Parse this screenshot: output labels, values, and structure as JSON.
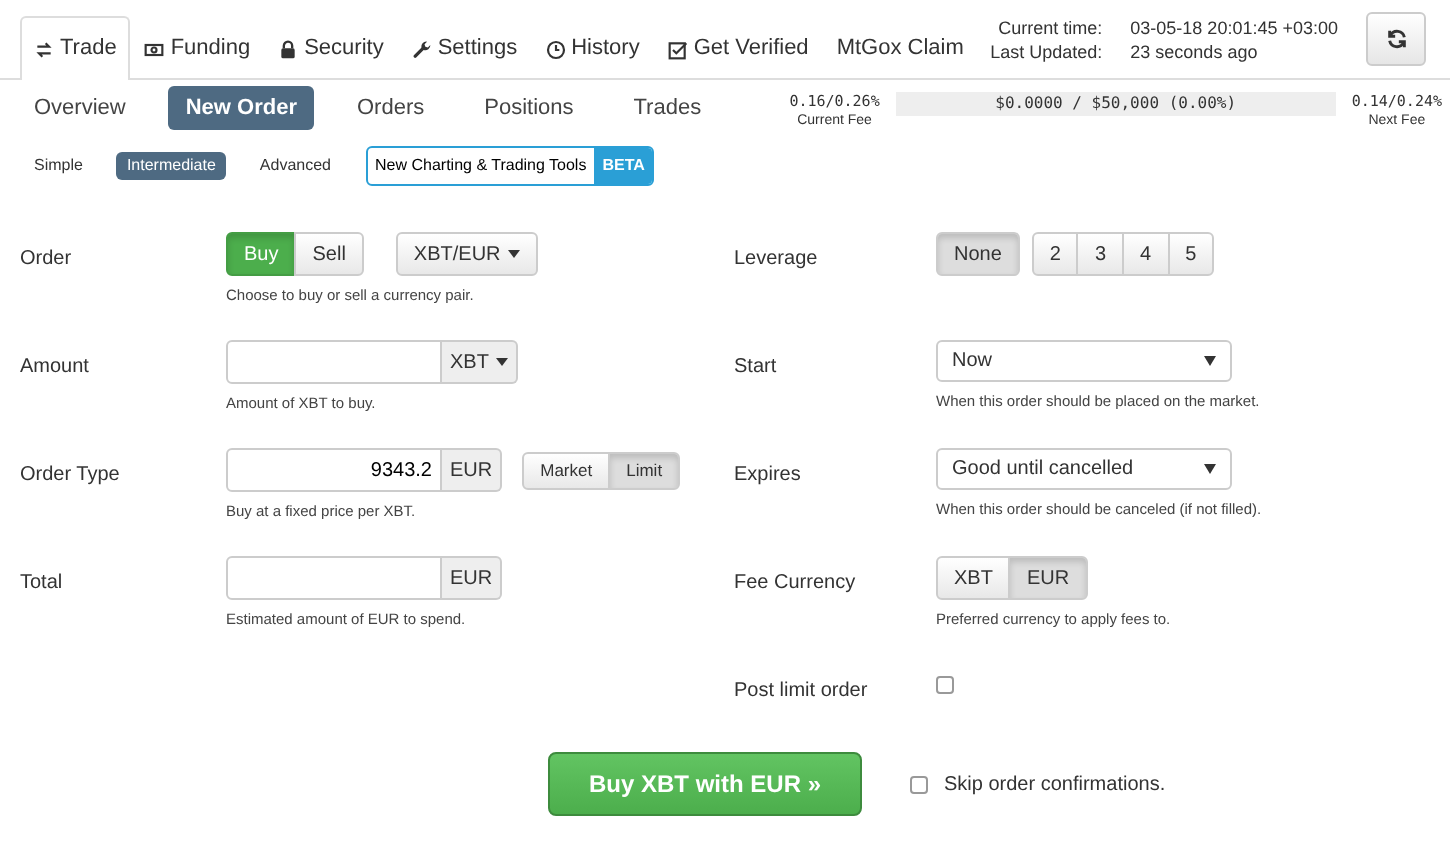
{
  "top_tabs": [
    {
      "label": "Trade",
      "selected": true
    },
    {
      "label": "Funding",
      "selected": false
    },
    {
      "label": "Security",
      "selected": false
    },
    {
      "label": "Settings",
      "selected": false
    },
    {
      "label": "History",
      "selected": false
    },
    {
      "label": "Get Verified",
      "selected": false
    },
    {
      "label": "MtGox Claim",
      "selected": false
    }
  ],
  "status": [
    {
      "label": "Current time:",
      "value": "03-05-18 20:01:45 +03:00"
    },
    {
      "label": "Last Updated:",
      "value": "23 seconds ago"
    }
  ],
  "sub_tabs": [
    {
      "label": "Overview",
      "selected": false
    },
    {
      "label": "New Order",
      "selected": true
    },
    {
      "label": "Orders",
      "selected": false
    },
    {
      "label": "Positions",
      "selected": false
    },
    {
      "label": "Trades",
      "selected": false
    }
  ],
  "fees": {
    "current": "0.16/0.26%",
    "current_label": "Current Fee",
    "volume": "$0.0000 / $50,000 (0.00%)",
    "next": "0.14/0.24%",
    "next_label": "Next Fee"
  },
  "modes": [
    {
      "label": "Simple",
      "selected": false
    },
    {
      "label": "Intermediate",
      "selected": true
    },
    {
      "label": "Advanced",
      "selected": false
    }
  ],
  "beta_link": {
    "label": "New Charting & Trading Tools",
    "badge": "BETA"
  },
  "left_rows": [
    {
      "kind": "order",
      "label": "Order",
      "buttons": [
        {
          "label": "Buy",
          "selected": true
        },
        {
          "label": "Sell",
          "selected": false
        }
      ],
      "pair": "XBT/EUR",
      "help": "Choose to buy or sell a currency pair."
    },
    {
      "kind": "amount",
      "label": "Amount",
      "unit": "XBT",
      "help": "Amount of XBT to buy."
    },
    {
      "kind": "price",
      "label": "Order Type",
      "value": "9343.2",
      "unit": "EUR",
      "buttons": [
        {
          "label": "Market",
          "selected": false
        },
        {
          "label": "Limit",
          "selected": true
        }
      ],
      "help": "Buy at a fixed price per XBT."
    },
    {
      "kind": "total",
      "label": "Total",
      "unit": "EUR",
      "help": "Estimated amount of EUR to spend."
    }
  ],
  "right_rows": [
    {
      "kind": "buttons",
      "label": "Leverage",
      "buttons": [
        {
          "label": "None",
          "selected": true
        },
        {
          "label": "2",
          "selected": false
        },
        {
          "label": "3",
          "selected": false
        },
        {
          "label": "4",
          "selected": false
        },
        {
          "label": "5",
          "selected": false
        }
      ]
    },
    {
      "kind": "select",
      "label": "Start",
      "value": "Now",
      "help": "When this order should be placed on the market."
    },
    {
      "kind": "select",
      "label": "Expires",
      "value": "Good until cancelled",
      "help": "When this order should be canceled (if not filled)."
    },
    {
      "kind": "toggle",
      "label": "Fee Currency",
      "buttons": [
        {
          "label": "XBT",
          "selected": false
        },
        {
          "label": "EUR",
          "selected": true
        }
      ],
      "help": "Preferred currency to apply fees to."
    },
    {
      "kind": "checkbox",
      "label": "Post limit order",
      "checked": false
    }
  ],
  "submit": {
    "label": "Buy XBT with EUR »"
  },
  "skip": {
    "label": "Skip order confirmations.",
    "checked": false
  }
}
